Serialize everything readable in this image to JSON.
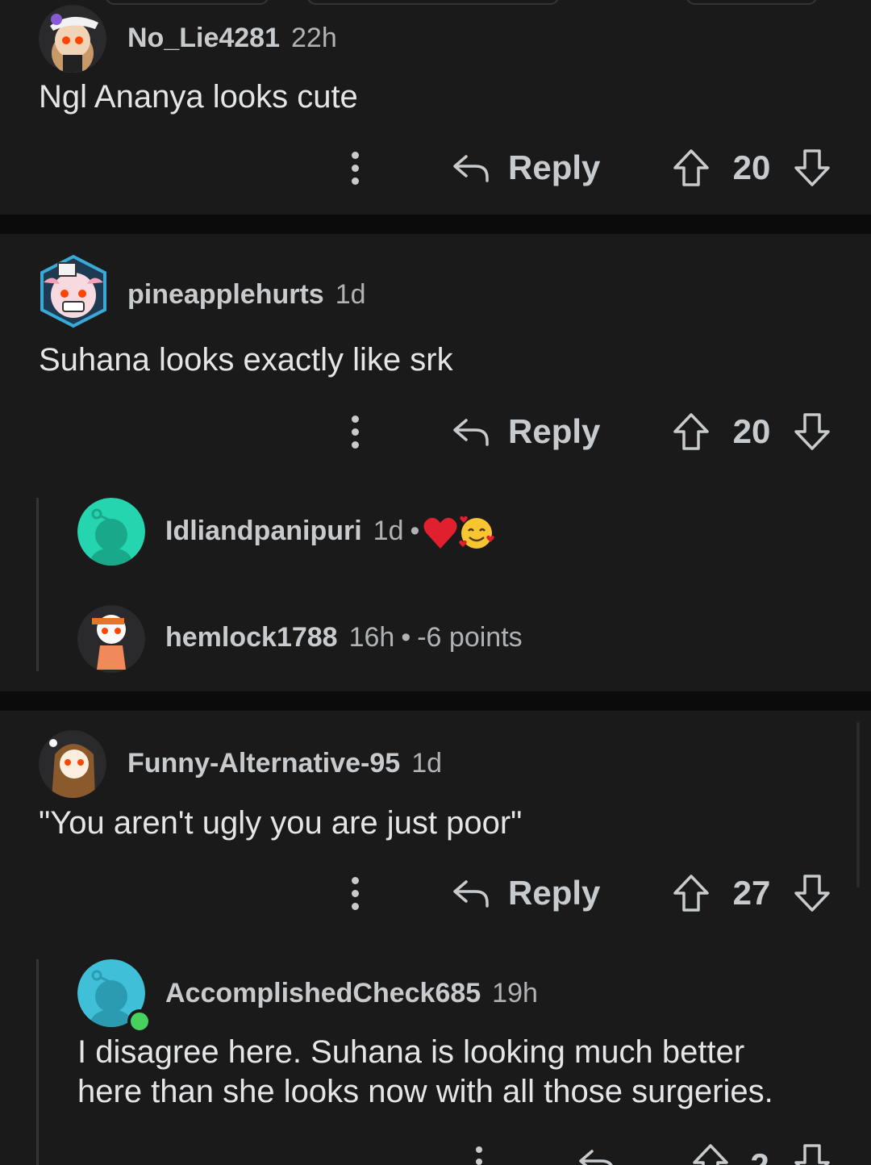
{
  "colors": {
    "background": "#0b0b0c",
    "card": "#1a1a1b",
    "text": "#d7dadc",
    "muted": "#b0b3b5",
    "thread_line": "#343536",
    "online": "#46d160"
  },
  "comments": [
    {
      "username": "No_Lie4281",
      "time": "22h",
      "body": "Ngl Ananya looks cute",
      "reply_label": "Reply",
      "score": "20"
    },
    {
      "username": "pineapplehurts",
      "time": "1d",
      "body": "Suhana looks exactly like srk",
      "reply_label": "Reply",
      "score": "20",
      "collapsed_replies": [
        {
          "username": "Idliandpanipuri",
          "time": "1d",
          "separator": "•",
          "flair_icons": [
            "red-heart-emoji-icon",
            "smiling-face-with-hearts-emoji-icon"
          ]
        },
        {
          "username": "hemlock1788",
          "time": "16h",
          "separator": "•",
          "points": "-6 points"
        }
      ]
    },
    {
      "username": "Funny-Alternative-95",
      "time": "1d",
      "body": "\"You aren't ugly you are just poor\"",
      "reply_label": "Reply",
      "score": "27",
      "replies": [
        {
          "username": "AccomplishedCheck685",
          "time": "19h",
          "body_line1": "I disagree here. Suhana is looking much better",
          "body_line2": "here than she looks now with all those surgeries.",
          "score": "2"
        }
      ]
    }
  ]
}
